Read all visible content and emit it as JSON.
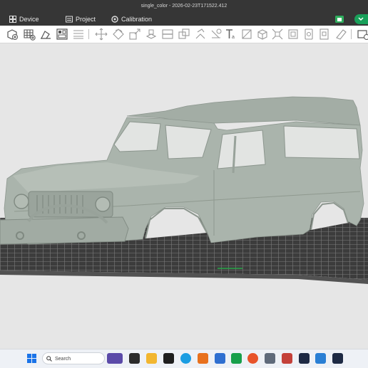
{
  "window": {
    "title": "single_color - 2026-02-23T171522.412"
  },
  "nav": {
    "device": "Device",
    "project": "Project",
    "calibration": "Calibration"
  },
  "taskbar": {
    "search_placeholder": "Search"
  },
  "colors": {
    "titlebar": "#363636",
    "accent": "#19a05a",
    "model": "#a9b3ab",
    "plate": "#3e3e3e",
    "viewport": "#e6e6e6"
  }
}
